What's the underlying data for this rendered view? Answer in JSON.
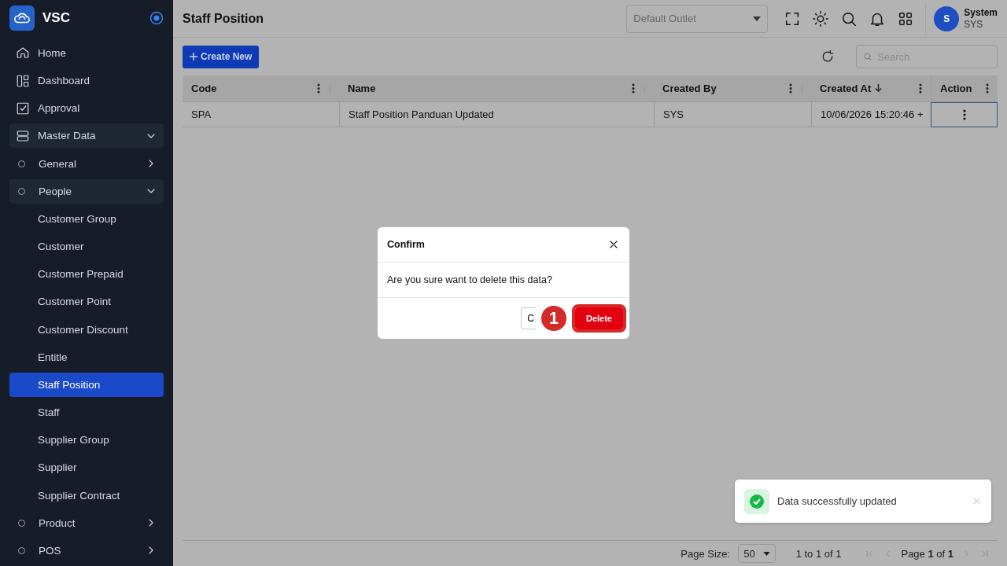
{
  "sidebar": {
    "brand": "VSC",
    "items": [
      {
        "label": "Home",
        "selected": false
      },
      {
        "label": "Dashboard",
        "selected": false
      },
      {
        "label": "Approval",
        "selected": false
      },
      {
        "label": "Master Data",
        "selected": false,
        "expanded": true,
        "children": [
          {
            "label": "General",
            "selected": false,
            "expanded": false
          },
          {
            "label": "People",
            "selected": false,
            "expanded": true,
            "children": [
              {
                "label": "Customer Group",
                "selected": false
              },
              {
                "label": "Customer",
                "selected": false
              },
              {
                "label": "Customer Prepaid",
                "selected": false
              },
              {
                "label": "Customer Point",
                "selected": false
              },
              {
                "label": "Customer Discount",
                "selected": false
              },
              {
                "label": "Entitle",
                "selected": false
              },
              {
                "label": "Staff Position",
                "selected": true
              },
              {
                "label": "Staff",
                "selected": false
              },
              {
                "label": "Supplier Group",
                "selected": false
              },
              {
                "label": "Supplier",
                "selected": false
              },
              {
                "label": "Supplier Contract",
                "selected": false
              }
            ]
          },
          {
            "label": "Product",
            "selected": false,
            "expanded": false
          },
          {
            "label": "POS",
            "selected": false,
            "expanded": false
          }
        ]
      }
    ]
  },
  "header": {
    "title": "Staff Position",
    "outlet": {
      "placeholder": "Default Outlet"
    },
    "user": {
      "initial": "S",
      "name": "System",
      "code": "SYS"
    }
  },
  "toolbar": {
    "create_label": "Create New",
    "search": {
      "placeholder": "Search"
    }
  },
  "table": {
    "columns": [
      {
        "label": "Code",
        "sorted": false
      },
      {
        "label": "Name",
        "sorted": false
      },
      {
        "label": "Created By",
        "sorted": false
      },
      {
        "label": "Created At",
        "sorted": true
      },
      {
        "label": "Action",
        "sorted": false
      }
    ],
    "rows": [
      {
        "cells": [
          "SPA",
          "Staff Position Panduan Updated",
          "SYS",
          "10/06/2026 15:20:46 +"
        ],
        "action_focused": true
      }
    ]
  },
  "pagination": {
    "page_size_label": "Page Size:",
    "page_size": "50",
    "range": "1 to 1 of 1",
    "page": "Page **1** of **1**"
  },
  "dialog": {
    "title": "Confirm",
    "message": "Are you sure want to delete this data?",
    "cancel_label": "C",
    "delete_label": "Delete",
    "delete_highlighted": true,
    "step_badge": "1"
  },
  "toast": {
    "kind": "success",
    "message": "Data successfully updated"
  }
}
